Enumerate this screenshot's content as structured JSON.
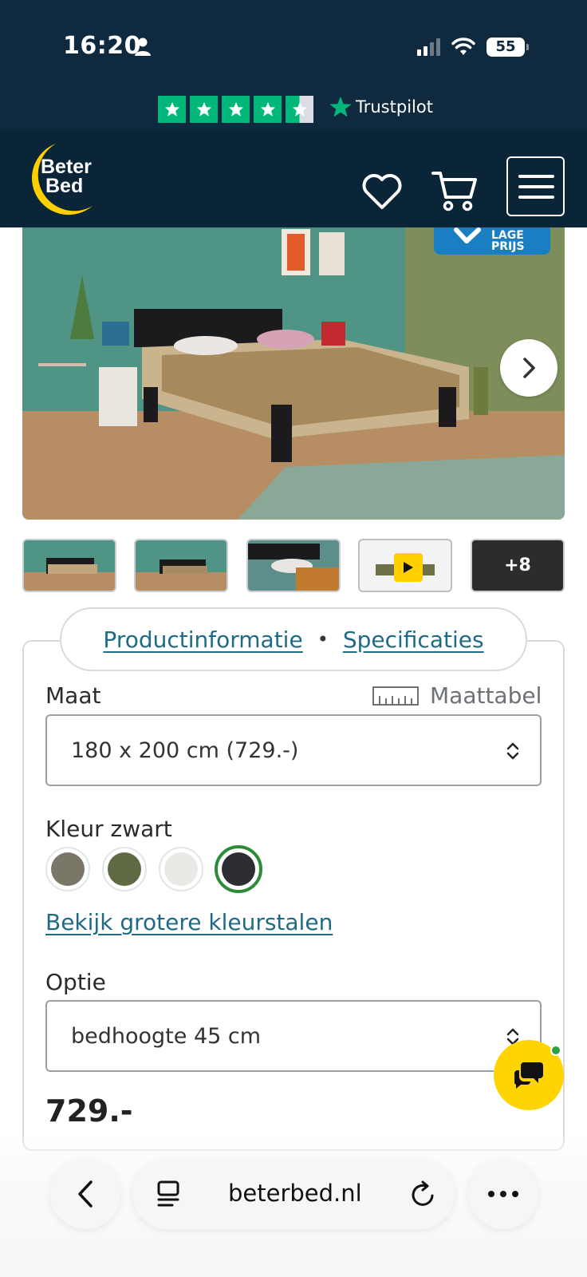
{
  "status_bar": {
    "time": "16:20",
    "battery": "55"
  },
  "trustpilot": {
    "label": "Trustpilot",
    "rating_stars": 4.5
  },
  "header": {
    "logo_line1": "Beter",
    "logo_line2": "Bed",
    "icons": [
      "heart-icon",
      "cart-icon",
      "hamburger-menu-icon"
    ]
  },
  "hero": {
    "badge_line1": "LAGE",
    "badge_line2": "PRIJS"
  },
  "thumbnails": {
    "more_count": "+8"
  },
  "tabs": {
    "product_info": "Productinformatie",
    "separator": "•",
    "specs": "Specificaties"
  },
  "size": {
    "label": "Maat",
    "size_table_label": "Maattabel",
    "selected": "180 x 200 cm (729.-)"
  },
  "color": {
    "label": "Kleur zwart",
    "swatches": [
      "#7a7668",
      "#5f6a45",
      "#e9e9e6",
      "#2d2d33"
    ],
    "selected_index": 3,
    "larger_swatches_link": "Bekijk grotere kleurstalen"
  },
  "option": {
    "label": "Optie",
    "selected": "bedhoogte 45 cm"
  },
  "price": "729.-",
  "browser": {
    "url": "beterbed.nl"
  },
  "colors": {
    "header_bg": "#0a2438",
    "accent_link": "#1f6a84",
    "trustpilot_green": "#00b67a",
    "chat_yellow": "#ffd400",
    "selected_ring": "#2e8b3a"
  }
}
